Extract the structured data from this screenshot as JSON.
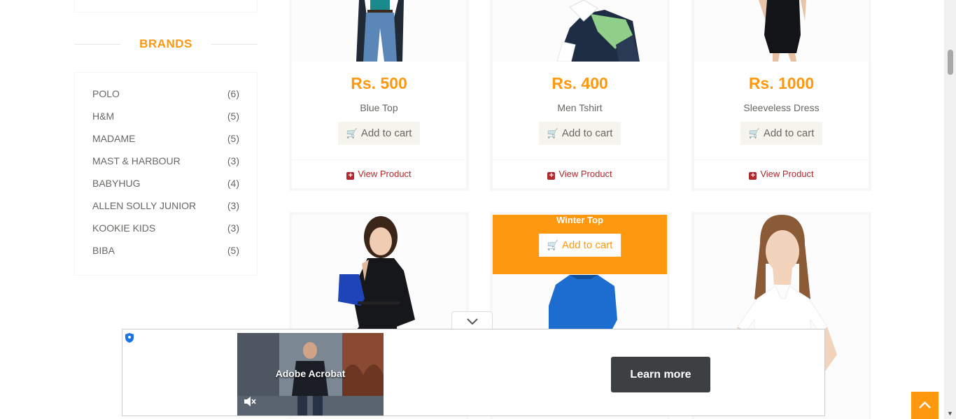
{
  "sidebar": {
    "brands_title": "BRANDS",
    "brands": [
      {
        "name": "POLO",
        "count": "(6)"
      },
      {
        "name": "H&M",
        "count": "(5)"
      },
      {
        "name": "MADAME",
        "count": "(5)"
      },
      {
        "name": "MAST & HARBOUR",
        "count": "(3)"
      },
      {
        "name": "BABYHUG",
        "count": "(4)"
      },
      {
        "name": "ALLEN SOLLY JUNIOR",
        "count": "(3)"
      },
      {
        "name": "KOOKIE KIDS",
        "count": "(3)"
      },
      {
        "name": "BIBA",
        "count": "(5)"
      }
    ]
  },
  "products": [
    {
      "price": "Rs. 500",
      "name": "Blue Top",
      "cart_label": "Add to cart",
      "view_label": "View Product"
    },
    {
      "price": "Rs. 400",
      "name": "Men Tshirt",
      "cart_label": "Add to cart",
      "view_label": "View Product"
    },
    {
      "price": "Rs. 1000",
      "name": "Sleeveless Dress",
      "cart_label": "Add to cart",
      "view_label": "View Product"
    }
  ],
  "hover_overlay": {
    "name": "Winter Top",
    "cart_label": "Add to cart"
  },
  "ad": {
    "video_text": "Adobe Acrobat",
    "cta_label": "Learn more"
  },
  "colors": {
    "accent": "#fe980f",
    "link": "#b3272d",
    "button_bg": "#f5f5ed",
    "ad_cta": "#3c4043"
  }
}
